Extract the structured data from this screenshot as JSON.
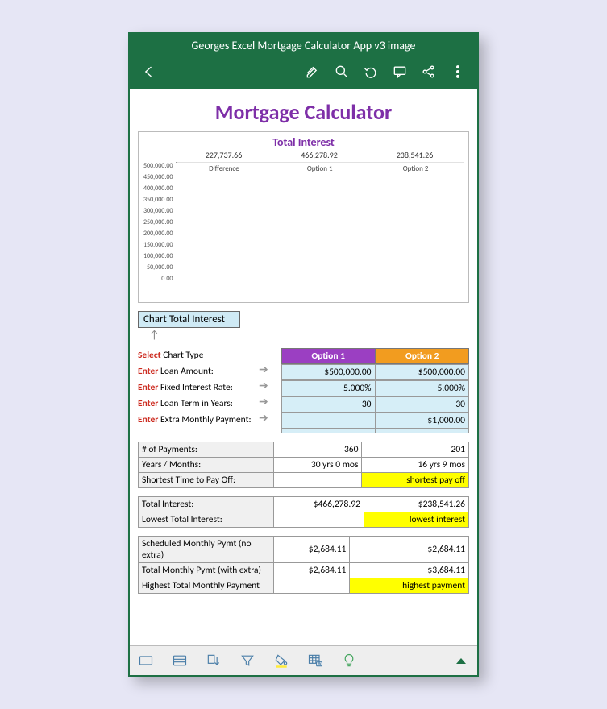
{
  "app_title": "Georges Excel Mortgage Calculator App v3 image",
  "page_title": "Mortgage Calculator",
  "chart_data": {
    "type": "bar",
    "title": "Total Interest",
    "categories": [
      "Difference",
      "Option 1",
      "Option 2"
    ],
    "values": [
      227737.66,
      466278.92,
      238541.26
    ],
    "data_labels": [
      "227,737.66",
      "466,278.92",
      "238,541.26"
    ],
    "ylim": [
      0,
      500000
    ],
    "yticks": [
      "500,000.00",
      "450,000.00",
      "400,000.00",
      "350,000.00",
      "300,000.00",
      "250,000.00",
      "200,000.00",
      "150,000.00",
      "100,000.00",
      "50,000.00",
      "0.00"
    ],
    "colors": [
      "#7cc242",
      "#9b3fc2",
      "#f29c1f"
    ]
  },
  "selector_value": "Chart Total Interest",
  "select_label_prefix": "Select",
  "select_label_text": "Chart Type",
  "enter_prefix": "Enter",
  "inputs": {
    "headers": {
      "option1": "Option 1",
      "option2": "Option 2"
    },
    "rows": [
      {
        "label": "Loan Amount:",
        "o1": "$500,000.00",
        "o2": "$500,000.00"
      },
      {
        "label": "Fixed Interest Rate:",
        "o1": "5.000%",
        "o2": "5.000%"
      },
      {
        "label": "Loan Term in Years:",
        "o1": "30",
        "o2": "30"
      },
      {
        "label": "Extra Monthly Payment:",
        "o1": "",
        "o2": "$1,000.00"
      }
    ]
  },
  "results1": [
    {
      "label": "# of Payments:",
      "o1": "360",
      "o2": "201"
    },
    {
      "label": "Years / Months:",
      "o1": "30 yrs 0 mos",
      "o2": "16 yrs 9 mos"
    },
    {
      "label": "Shortest Time to Pay Off:",
      "o1": "",
      "o2": "shortest pay off",
      "hl": true
    }
  ],
  "results2": [
    {
      "label": "Total Interest:",
      "o1": "$466,278.92",
      "o2": "$238,541.26"
    },
    {
      "label": "Lowest Total Interest:",
      "o1": "",
      "o2": "lowest interest",
      "hl": true
    }
  ],
  "results3": [
    {
      "label": "Scheduled Monthly Pymt (no extra)",
      "o1": "$2,684.11",
      "o2": "$2,684.11"
    },
    {
      "label": "Total Monthly Pymt (with extra)",
      "o1": "$2,684.11",
      "o2": "$3,684.11"
    },
    {
      "label": "Highest Total Monthly Payment",
      "o1": "",
      "o2": "highest payment",
      "hl": true
    }
  ]
}
